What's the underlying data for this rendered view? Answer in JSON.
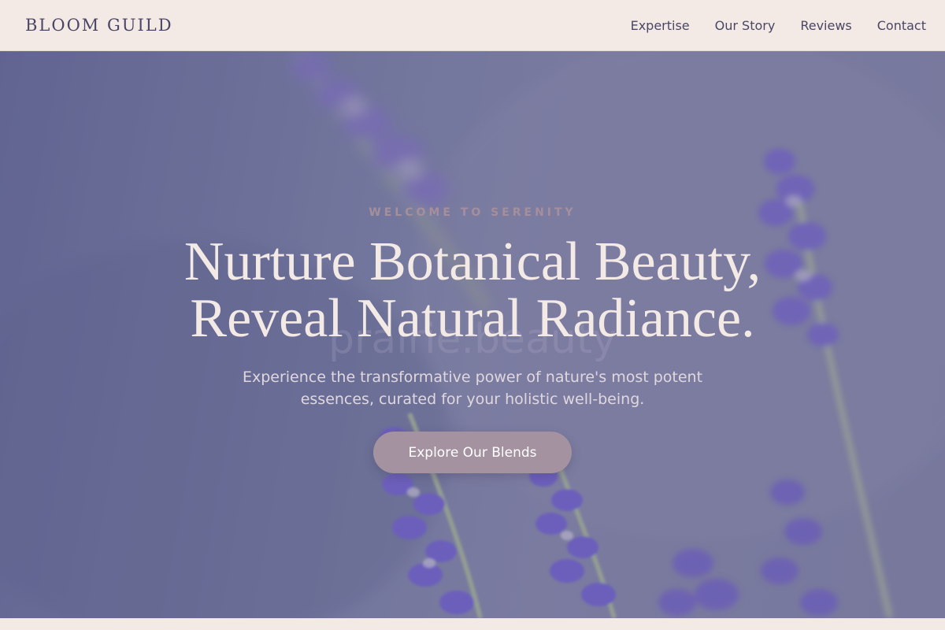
{
  "header": {
    "brand": "BLOOM GUILD",
    "nav": [
      "Expertise",
      "Our Story",
      "Reviews",
      "Contact"
    ]
  },
  "hero": {
    "eyebrow": "WELCOME TO SERENITY",
    "headline_line1": "Nurture Botanical Beauty,",
    "headline_line2": "Reveal Natural Radiance.",
    "watermark": "prairie.beauty",
    "subtext": "Experience the transformative power of nature's most potent essences, curated for your holistic well-being.",
    "cta_label": "Explore Our Blends",
    "background_image": "lavender-flowers-image"
  },
  "colors": {
    "header_bg": "#f3eae6",
    "text_dark": "#4a4664",
    "cta_bg": "#a592a0",
    "eyebrow": "#a58f9c",
    "headline": "#f3eae6"
  }
}
